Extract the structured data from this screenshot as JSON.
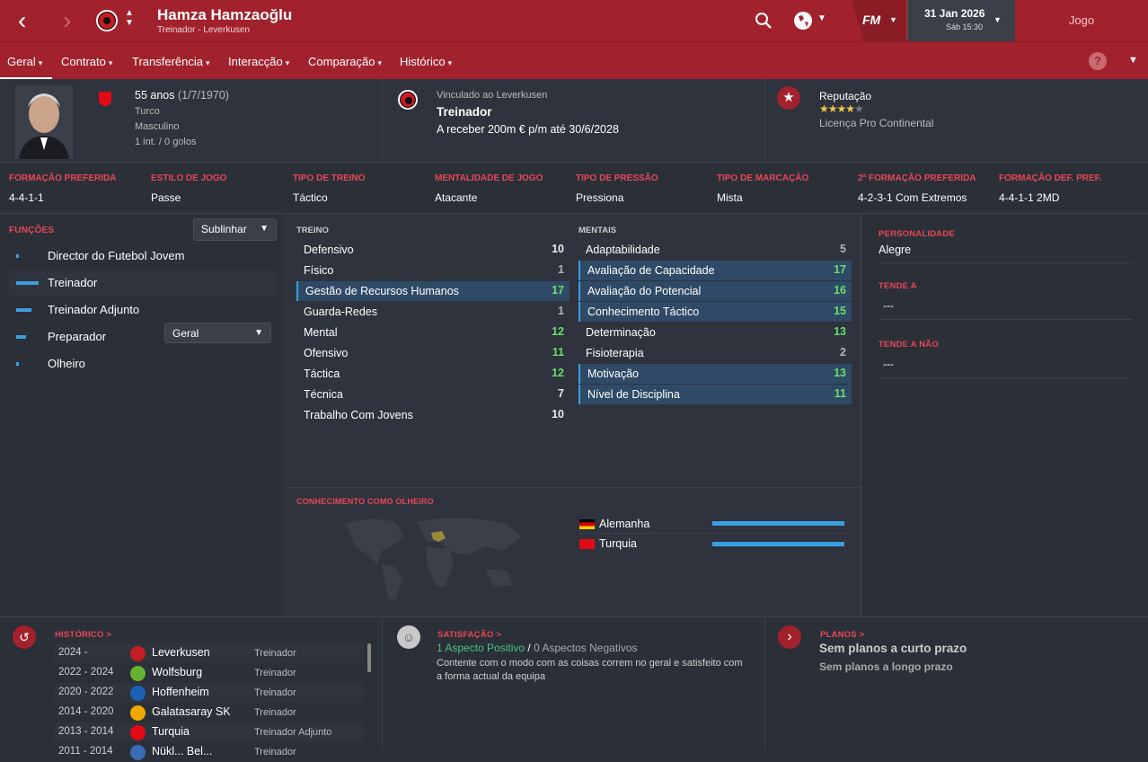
{
  "header": {
    "name": "Hamza Hamzaoğlu",
    "subtitle": "Treinador - Leverkusen",
    "date": "31 Jan 2026",
    "time": "Sáb 15:30",
    "game_button": "Jogo",
    "fm_logo": "FM"
  },
  "nav": {
    "items": [
      "Geral",
      "Contrato",
      "Transferência",
      "Interacção",
      "Comparação",
      "Histórico"
    ]
  },
  "profile": {
    "age": "55 anos",
    "dob": "(1/7/1970)",
    "nationality": "Turco",
    "gender": "Masculino",
    "caps": "1 int. / 0 golos",
    "contract_label": "Vinculado ao Leverkusen",
    "job": "Treinador",
    "wage": "A receber 200m € p/m até 30/6/2028",
    "reputation_label": "Reputação",
    "reputation_stars": 4,
    "license": "Licença Pro Continental"
  },
  "prefs": [
    {
      "label": "FORMAÇÃO PREFERIDA",
      "value": "4-4-1-1"
    },
    {
      "label": "ESTILO DE JOGO",
      "value": "Passe"
    },
    {
      "label": "TIPO DE TREINO",
      "value": "Táctico"
    },
    {
      "label": "MENTALIDADE DE JOGO",
      "value": "Atacante"
    },
    {
      "label": "TIPO DE PRESSÃO",
      "value": "Pressiona"
    },
    {
      "label": "TIPO DE MARCAÇÃO",
      "value": "Mista"
    },
    {
      "label": "2ª FORMAÇÃO PREFERIDA",
      "value": "4-2-3-1 Com Extremos"
    },
    {
      "label": "FORMAÇÃO DEF. PREF.",
      "value": "4-4-1-1 2MD"
    }
  ],
  "roles": {
    "title": "FUNÇÕES",
    "dropdown": "Sublinhar",
    "items": [
      {
        "label": "Director do Futebol Jovem",
        "level": 0.1
      },
      {
        "label": "Treinador",
        "level": 0.9
      },
      {
        "label": "Treinador Adjunto",
        "level": 0.6
      },
      {
        "label": "Preparador",
        "level": 0.4
      },
      {
        "label": "Olheiro",
        "level": 0.1
      }
    ],
    "preparador_select": "Geral"
  },
  "training": {
    "title": "TREINO",
    "items": [
      {
        "name": "Defensivo",
        "value": "10"
      },
      {
        "name": "Físico",
        "value": "1"
      },
      {
        "name": "Gestão de Recursos Humanos",
        "value": "17"
      },
      {
        "name": "Guarda-Redes",
        "value": "1"
      },
      {
        "name": "Mental",
        "value": "12"
      },
      {
        "name": "Ofensivo",
        "value": "11"
      },
      {
        "name": "Táctica",
        "value": "12"
      },
      {
        "name": "Técnica",
        "value": "7"
      },
      {
        "name": "Trabalho Com Jovens",
        "value": "10"
      }
    ]
  },
  "mental": {
    "title": "MENTAIS",
    "items": [
      {
        "name": "Adaptabilidade",
        "value": "5"
      },
      {
        "name": "Avaliação de Capacidade",
        "value": "17"
      },
      {
        "name": "Avaliação do Potencial",
        "value": "16"
      },
      {
        "name": "Conhecimento Táctico",
        "value": "15"
      },
      {
        "name": "Determinação",
        "value": "13"
      },
      {
        "name": "Fisioterapia",
        "value": "2"
      },
      {
        "name": "Motivação",
        "value": "13"
      },
      {
        "name": "Nível de Disciplina",
        "value": "11"
      }
    ]
  },
  "scouting": {
    "title": "CONHECIMENTO COMO OLHEIRO",
    "countries": [
      {
        "name": "Alemanha",
        "level": 1.0
      },
      {
        "name": "Turquia",
        "level": 1.0
      }
    ]
  },
  "personality": {
    "title": "PERSONALIDADE",
    "value": "Alegre",
    "tends_title": "TENDE A",
    "tends_value": "---",
    "tends_not_title": "TENDE A NÃO",
    "tends_not_value": "---"
  },
  "history": {
    "title": "HISTÓRICO >",
    "rows": [
      {
        "years": "2024 -",
        "club": "Leverkusen",
        "role": "Treinador"
      },
      {
        "years": "2022 - 2024",
        "club": "Wolfsburg",
        "role": "Treinador"
      },
      {
        "years": "2020 - 2022",
        "club": "Hoffenheim",
        "role": "Treinador"
      },
      {
        "years": "2014 - 2020",
        "club": "Galatasaray SK",
        "role": "Treinador"
      },
      {
        "years": "2013 - 2014",
        "club": "Turquia",
        "role": "Treinador Adjunto"
      },
      {
        "years": "2011 - 2014",
        "club": "Nükl... Bel...",
        "role": "Treinador"
      }
    ]
  },
  "satisfaction": {
    "title": "SATISFAÇÃO >",
    "positive": "1 Aspecto Positivo",
    "separator": "/",
    "negative": "0 Aspectos Negativos",
    "text": "Contente com o modo com as coisas correm no geral e satisfeito com a forma actual da equipa"
  },
  "plans": {
    "title": "PLANOS >",
    "short": "Sem planos a curto prazo",
    "long": "Sem planos a longo prazo"
  },
  "colors": {
    "accent": "#a1222c",
    "highlight": "#e84855",
    "bar": "#3a9fe0",
    "good": "#6fdc6f"
  }
}
